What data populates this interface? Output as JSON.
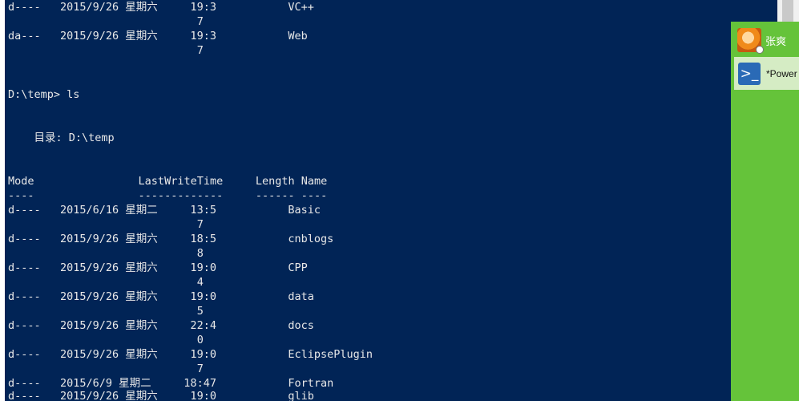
{
  "console": {
    "lines": [
      "d----   2015/9/26 星期六     19:3           VC++",
      "                             7",
      "da---   2015/9/26 星期六     19:3           Web",
      "                             7",
      "D:\\temp> ls",
      "    目录: D:\\temp",
      "Mode                LastWriteTime     Length Name",
      "----                -------------     ------ ----",
      "d----   2015/6/16 星期二     13:5           Basic",
      "                             7",
      "d----   2015/9/26 星期六     18:5           cnblogs",
      "                             8",
      "d----   2015/9/26 星期六     19:0           CPP",
      "                             4",
      "d----   2015/9/26 星期六     19:0           data",
      "                             5",
      "d----   2015/9/26 星期六     22:4           docs",
      "                             0",
      "d----   2015/9/26 星期六     19:0           EclipsePlugin",
      "                             7",
      "d----   2015/6/9 星期二     18:47           Fortran",
      "d----   2015/9/26 星期六     19:0           glib"
    ]
  },
  "tray": {
    "contact_name": "张爽",
    "task_label": "*Power",
    "task_icon": "powershell-icon",
    "accent": "#65c33a"
  },
  "colors": {
    "console_bg": "#012456",
    "console_fg": "#e8e8e8"
  }
}
